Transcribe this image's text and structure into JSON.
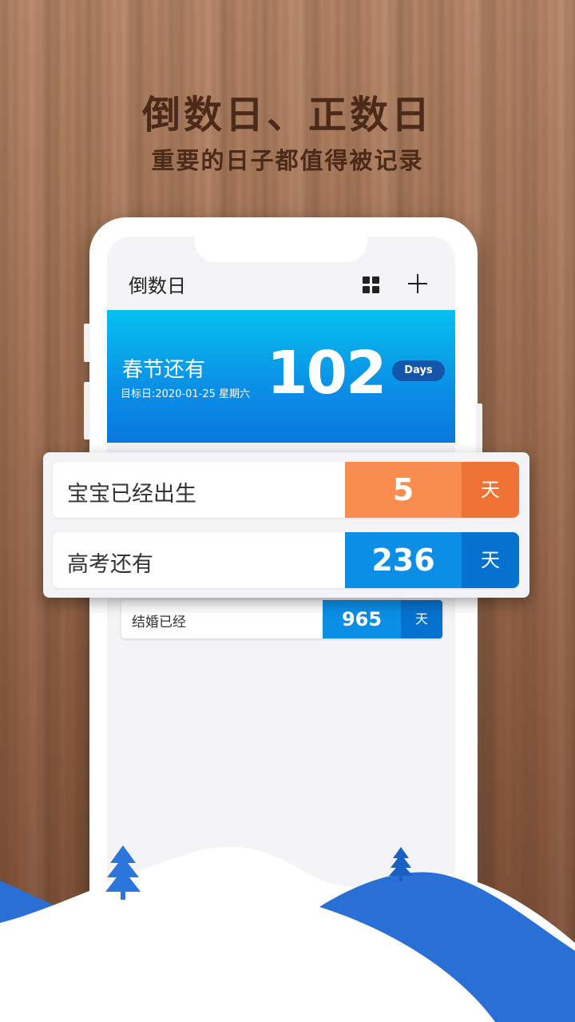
{
  "hero": {
    "title": "倒数日、正数日",
    "subtitle": "重要的日子都值得被记录"
  },
  "app": {
    "title": "倒数日",
    "grid_icon": "grid-icon",
    "add_icon": "plus-icon"
  },
  "banner": {
    "label": "春节还有",
    "date": "目标日:2020-01-25 星期六",
    "number": "102",
    "unit": "Days",
    "color": "#0a8ee6"
  },
  "popup_items": [
    {
      "label": "宝宝已经出生",
      "number": "5",
      "unit": "天",
      "num_color": "#f98d50",
      "unit_color": "#ed7234"
    },
    {
      "label": "高考还有",
      "number": "236",
      "unit": "天",
      "num_color": "#0a8ee6",
      "unit_color": "#0672cf"
    }
  ],
  "list_items": [
    {
      "label": "结婚已经",
      "number": "965",
      "unit": "天"
    }
  ],
  "decor": {
    "hill_color": "#2a6fd6",
    "tree_icon": "tree-icon"
  }
}
